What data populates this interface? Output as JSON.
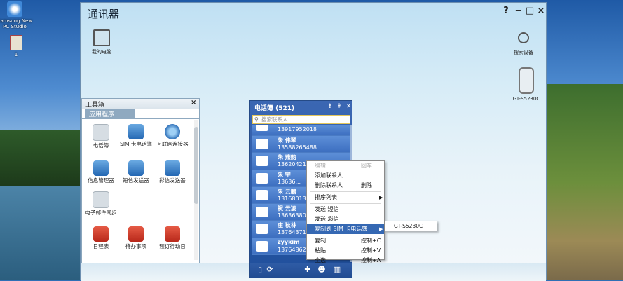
{
  "desktop": {
    "icons": [
      {
        "label": "Samsung New PC Studio"
      },
      {
        "label": "1"
      }
    ]
  },
  "app": {
    "title": "通讯器",
    "controls": {
      "help": "?",
      "minimize": "−",
      "maximize": "□",
      "close": "×"
    },
    "my_computer": "我的电脑",
    "search_device": "搜索设备",
    "device": "GT-S5230C"
  },
  "toolbox": {
    "title": "工具箱",
    "close": "×",
    "tab": "应用程序",
    "tools": [
      {
        "label": "电话簿"
      },
      {
        "label": "SIM 卡电话簿"
      },
      {
        "label": "互联网连接器"
      },
      {
        "label": "信息管理器"
      },
      {
        "label": "短信发送器"
      },
      {
        "label": "彩信发送器"
      },
      {
        "label": "电子邮件同步"
      },
      {
        "label": "日程表"
      },
      {
        "label": "待办事项"
      },
      {
        "label": "预订行动日"
      }
    ]
  },
  "phonebook": {
    "title": "电话簿 (521)",
    "search_placeholder": "搜索联系人...",
    "rows": [
      {
        "name": "",
        "number": "13917952018"
      },
      {
        "name": "朱 伟琴",
        "number": "13588265488"
      },
      {
        "name": "朱 燕韵",
        "number": "13620421"
      },
      {
        "name": "朱 宇",
        "number": "13636..."
      },
      {
        "name": "朱 云鹏",
        "number": "13168013"
      },
      {
        "name": "祝 云凌",
        "number": "13636380"
      },
      {
        "name": "庄 秋林",
        "number": "13764371"
      },
      {
        "name": "zyykim",
        "number": "13764862"
      }
    ]
  },
  "context_menu": {
    "items": [
      {
        "label": "编辑",
        "shortcut": "回车",
        "disabled": true
      },
      {
        "label": "添加联系人",
        "shortcut": ""
      },
      {
        "label": "删除联系人",
        "shortcut": "删除"
      },
      {
        "label": "排序列表",
        "shortcut": "",
        "submenu": true
      },
      {
        "label": "发送 短信",
        "shortcut": ""
      },
      {
        "label": "发送 彩信",
        "shortcut": ""
      },
      {
        "label": "复制到 SIM 卡电话簿",
        "shortcut": "",
        "submenu": true,
        "active": true
      },
      {
        "label": "复制",
        "shortcut": "控制+C"
      },
      {
        "label": "粘贴",
        "shortcut": "控制+V"
      },
      {
        "label": "全选",
        "shortcut": "控制+A"
      }
    ],
    "submenu_item": "GT-S5230C"
  }
}
